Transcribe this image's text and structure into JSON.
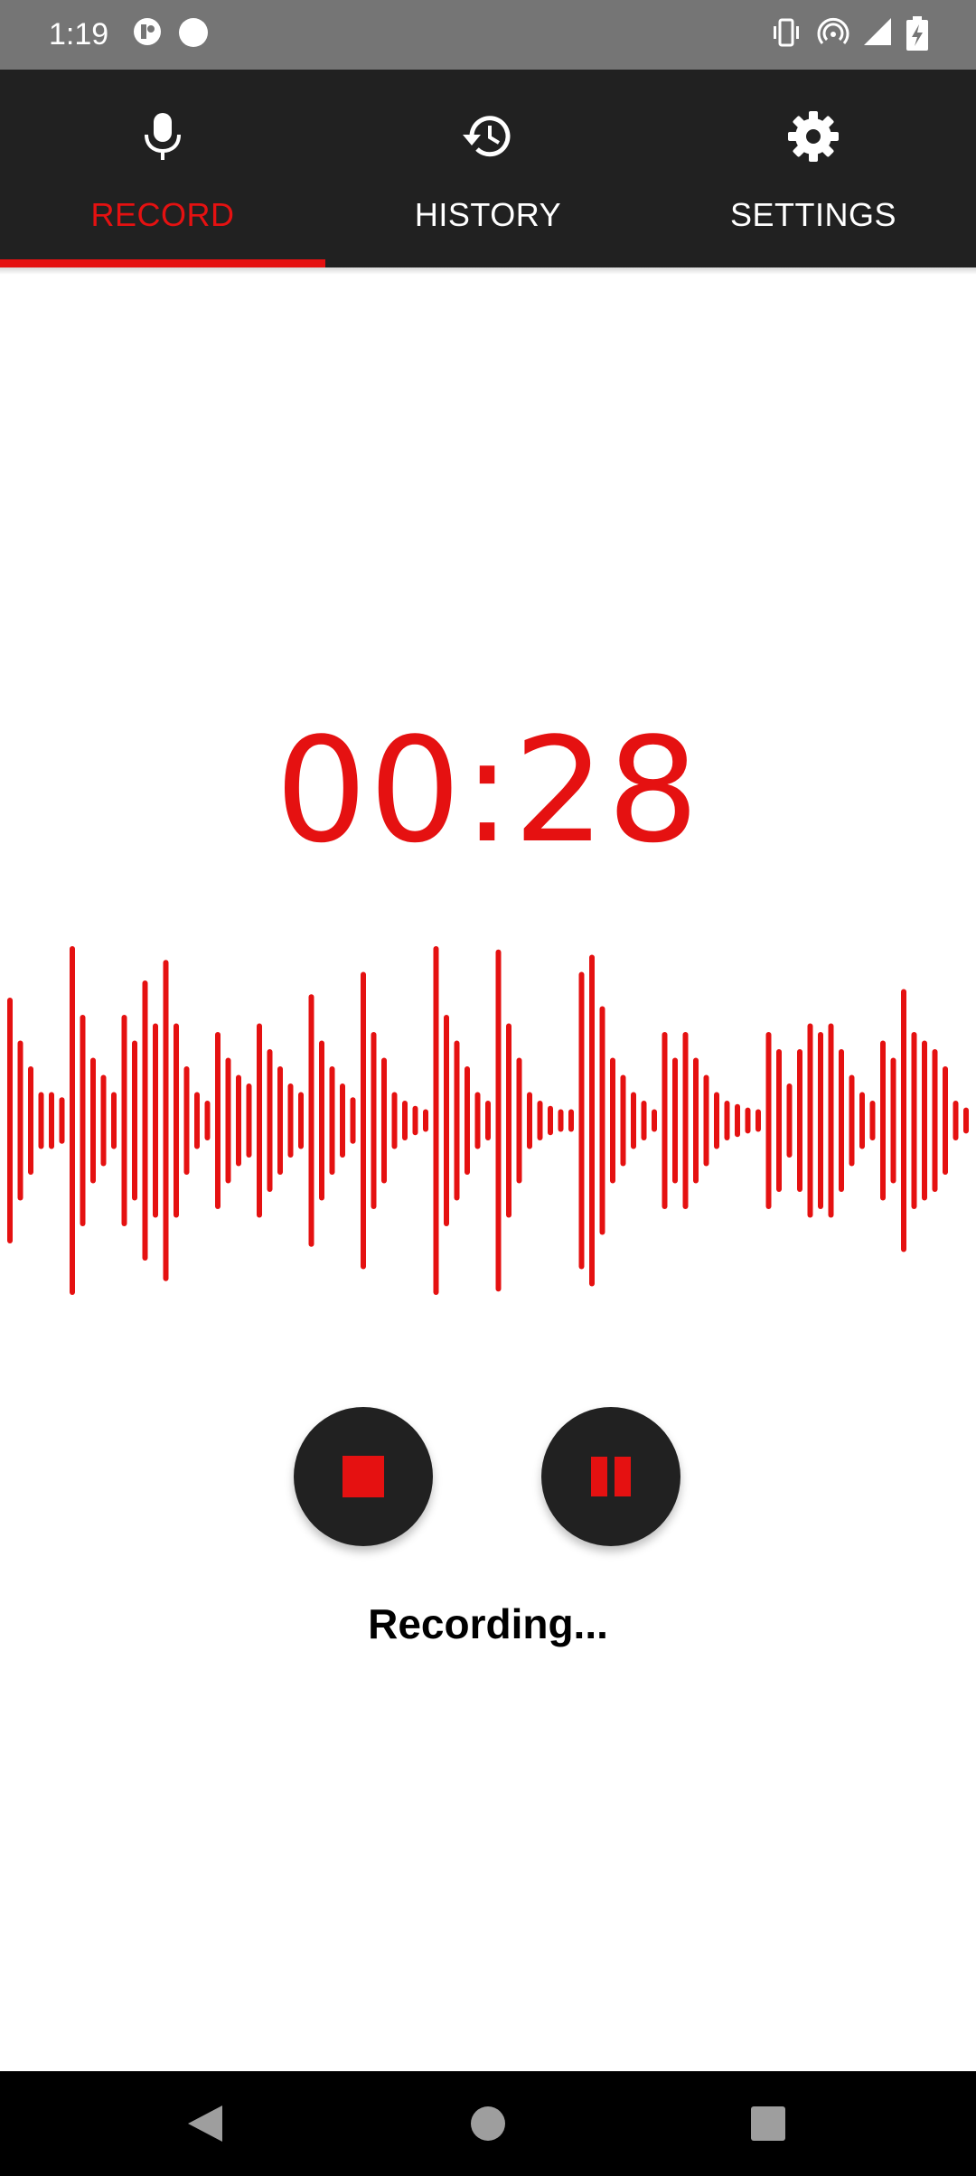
{
  "status_bar": {
    "time": "1:19",
    "icons": [
      "app-notification-icon",
      "circle-notification-icon",
      "vibrate-icon",
      "hotspot-icon",
      "signal-icon",
      "battery-charging-icon"
    ]
  },
  "tabs": [
    {
      "label": "RECORD",
      "icon": "microphone-icon",
      "active": true
    },
    {
      "label": "HISTORY",
      "icon": "history-icon",
      "active": false
    },
    {
      "label": "SETTINGS",
      "icon": "gear-icon",
      "active": false
    }
  ],
  "recorder": {
    "timer": "00:28",
    "status": "Recording...",
    "waveform_amplitudes": [
      0.7,
      0.45,
      0.3,
      0.15,
      0.15,
      0.12,
      1.0,
      0.6,
      0.35,
      0.25,
      0.15,
      0.6,
      0.45,
      0.8,
      0.55,
      0.92,
      0.55,
      0.3,
      0.15,
      0.1,
      0.5,
      0.35,
      0.25,
      0.2,
      0.55,
      0.4,
      0.3,
      0.2,
      0.15,
      0.72,
      0.45,
      0.3,
      0.2,
      0.12,
      0.85,
      0.5,
      0.35,
      0.15,
      0.1,
      0.07,
      0.05,
      1.0,
      0.6,
      0.45,
      0.3,
      0.15,
      0.1,
      0.98,
      0.55,
      0.35,
      0.15,
      0.1,
      0.07,
      0.05,
      0.05,
      0.85,
      0.95,
      0.65,
      0.35,
      0.25,
      0.15,
      0.1,
      0.05,
      0.5,
      0.35,
      0.5,
      0.35,
      0.25,
      0.15,
      0.1,
      0.08,
      0.06,
      0.05,
      0.5,
      0.4,
      0.2,
      0.4,
      0.55,
      0.5,
      0.55,
      0.4,
      0.25,
      0.15,
      0.1,
      0.45,
      0.35,
      0.75,
      0.5,
      0.45,
      0.4,
      0.3,
      0.1,
      0.06
    ]
  },
  "controls": {
    "stop_icon": "stop-icon",
    "pause_icon": "pause-icon"
  },
  "nav": [
    "back-icon",
    "home-icon",
    "recents-icon"
  ],
  "colors": {
    "accent": "#e51111",
    "tab_bar": "#212121",
    "status_bar": "#757575"
  }
}
